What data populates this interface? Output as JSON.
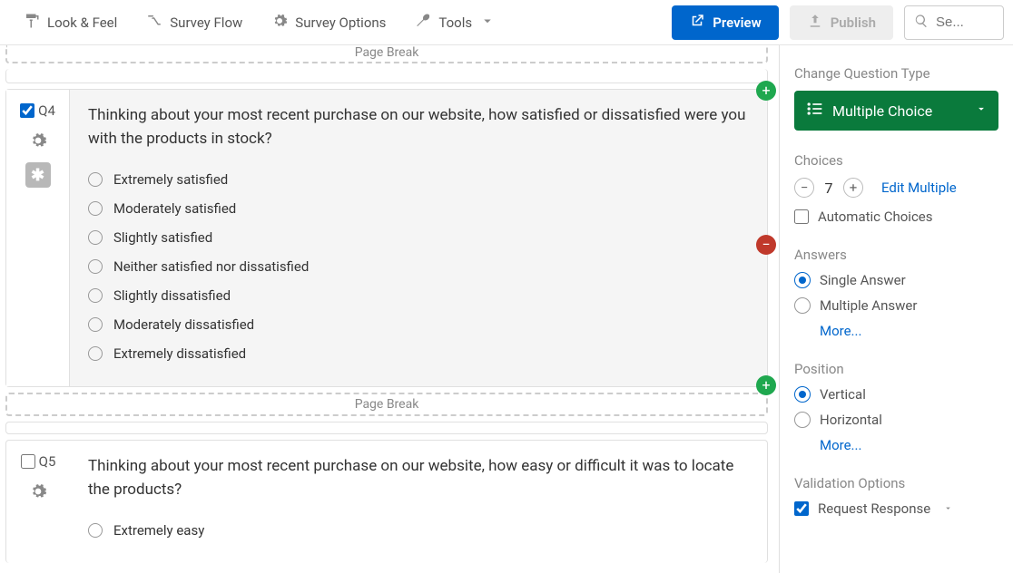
{
  "toolbar": {
    "look_feel": "Look & Feel",
    "survey_flow": "Survey Flow",
    "survey_options": "Survey Options",
    "tools": "Tools",
    "preview": "Preview",
    "publish": "Publish",
    "search_placeholder": "Se..."
  },
  "page_break_label": "Page Break",
  "q4": {
    "id": "Q4",
    "selected": true,
    "text": "Thinking about your most recent purchase on our website, how satisfied or dissatisfied were you with the products in stock?",
    "choices": [
      "Extremely satisfied",
      "Moderately satisfied",
      "Slightly satisfied",
      "Neither satisfied nor dissatisfied",
      "Slightly dissatisfied",
      "Moderately dissatisfied",
      "Extremely dissatisfied"
    ]
  },
  "q5": {
    "id": "Q5",
    "selected": false,
    "text": "Thinking about your most recent purchase on our website, how easy or difficult it was to locate the products?",
    "choices": [
      "Extremely easy"
    ]
  },
  "sidebar": {
    "change_type_label": "Change Question Type",
    "type_name": "Multiple Choice",
    "choices_label": "Choices",
    "choices_count": "7",
    "edit_multiple": "Edit Multiple",
    "automatic_choices": "Automatic Choices",
    "answers_label": "Answers",
    "answers": {
      "single": "Single Answer",
      "multiple": "Multiple Answer",
      "more": "More..."
    },
    "position_label": "Position",
    "position": {
      "vertical": "Vertical",
      "horizontal": "Horizontal",
      "more": "More..."
    },
    "validation_label": "Validation Options",
    "request_response": "Request Response"
  }
}
